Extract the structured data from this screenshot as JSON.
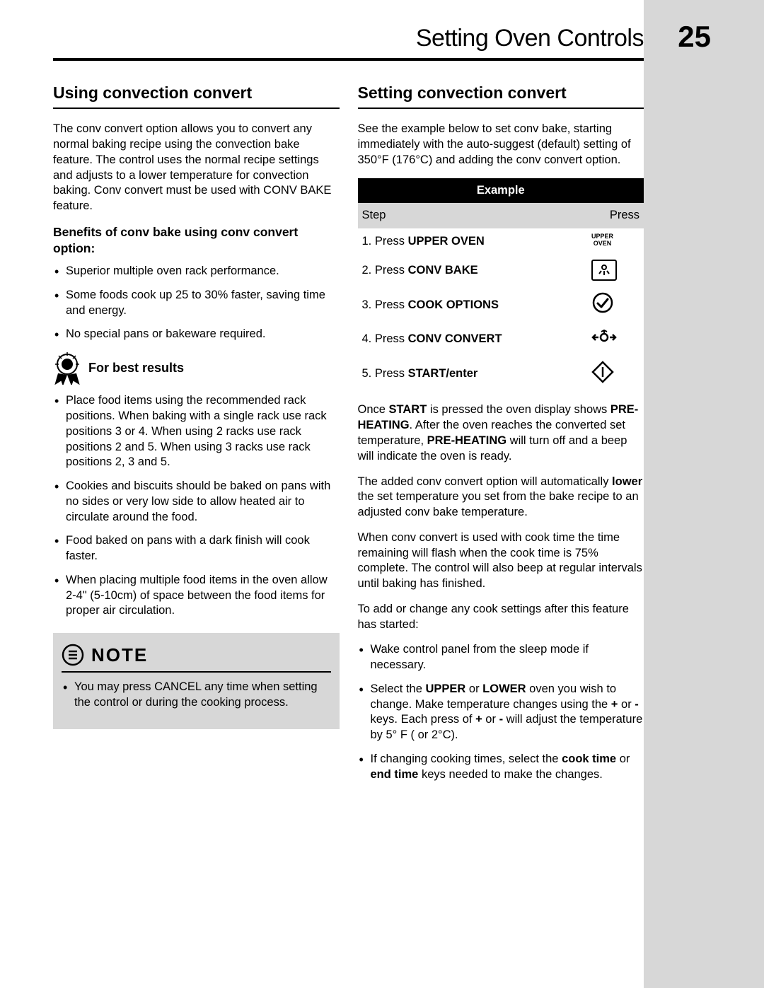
{
  "header": {
    "title": "Setting Oven Controls",
    "page_number": "25"
  },
  "left": {
    "section_title": "Using convection convert",
    "intro": "The  conv convert option allows you to convert any normal baking recipe using the convection bake feature. The control uses the normal recipe settings and adjusts to a lower temperature for convection baking. Conv convert must be used with CONV BAKE feature.",
    "benefits_heading": "Benefits of conv bake using conv convert option:",
    "benefits": [
      "Superior multiple oven rack performance.",
      "Some foods cook up 25 to 30% faster, saving time and energy.",
      "No special pans or bakeware required."
    ],
    "best_results_title": "For best results",
    "best_results": [
      "Place food items using the recommended rack positions. When baking with a single rack use rack positions 3 or 4. When using 2 racks use rack positions  2 and 5. When using 3 racks use rack positions 2, 3 and 5.",
      "Cookies and biscuits should be baked on pans with no sides or very low side to allow heated air to circulate around the food.",
      "Food baked on pans with a dark finish will cook faster.",
      "When placing multiple food items in the oven allow 2-4\" (5-10cm) of space between the food items for proper air circulation."
    ],
    "note_title": "NOTE",
    "note_items": [
      "You may press CANCEL any time when setting the control or during the cooking process."
    ]
  },
  "right": {
    "section_title": "Setting convection convert",
    "intro": "See the example below to set conv bake, starting immediately with the auto-suggest (default) setting of 350°F (176°C) and adding the conv convert option.",
    "example_label": "Example",
    "step_label": "Step",
    "press_label": "Press",
    "steps": [
      {
        "num": "1.",
        "prefix": "Press ",
        "bold": "UPPER OVEN",
        "button_line1": "UPPER",
        "button_line2": "OVEN"
      },
      {
        "num": "2.",
        "prefix": "Press ",
        "bold": "CONV BAKE"
      },
      {
        "num": "3.",
        "prefix": "Press ",
        "bold": "COOK OPTIONS"
      },
      {
        "num": "4.",
        "prefix": "Press ",
        "bold": "CONV CONVERT"
      },
      {
        "num": "5.",
        "prefix": "Press ",
        "bold": "START/enter"
      }
    ],
    "after_para_1_parts": [
      {
        "t": "Once "
      },
      {
        "t": "START",
        "b": true
      },
      {
        "t": " is pressed the oven display shows "
      },
      {
        "t": "PRE-HEATING",
        "b": true
      },
      {
        "t": ". After the oven reaches the converted set temperature, "
      },
      {
        "t": "PRE-HEATING",
        "b": true
      },
      {
        "t": " will turn off and a beep will indicate the oven is ready."
      }
    ],
    "after_para_2_parts": [
      {
        "t": "The added conv convert option will automatically "
      },
      {
        "t": "lower",
        "b": true
      },
      {
        "t": " the set temperature you set from the bake recipe to an adjusted conv bake temperature."
      }
    ],
    "after_para_3": "When conv convert is used with cook time the time remaining will flash when the cook time is 75% complete. The control will also beep at regular intervals until baking has finished.",
    "after_para_4": "To add or change any cook settings after this feature has started:",
    "change_items": [
      [
        {
          "t": "Wake control panel from the sleep mode if necessary."
        }
      ],
      [
        {
          "t": "Select the "
        },
        {
          "t": "UPPER",
          "b": true
        },
        {
          "t": " or "
        },
        {
          "t": "LOWER",
          "b": true
        },
        {
          "t": " oven you wish to change. Make temperature changes using the "
        },
        {
          "t": "+",
          "b": true
        },
        {
          "t": " or "
        },
        {
          "t": "-",
          "b": true
        },
        {
          "t": " keys. Each press of "
        },
        {
          "t": "+",
          "b": true
        },
        {
          "t": " or "
        },
        {
          "t": "-",
          "b": true
        },
        {
          "t": " will adjust the temperature by 5° F ( or 2°C)."
        }
      ],
      [
        {
          "t": "If changing cooking times, select the "
        },
        {
          "t": "cook time",
          "b": true
        },
        {
          "t": " or "
        },
        {
          "t": "end time",
          "b": true
        },
        {
          "t": " keys needed to make the changes."
        }
      ]
    ]
  }
}
